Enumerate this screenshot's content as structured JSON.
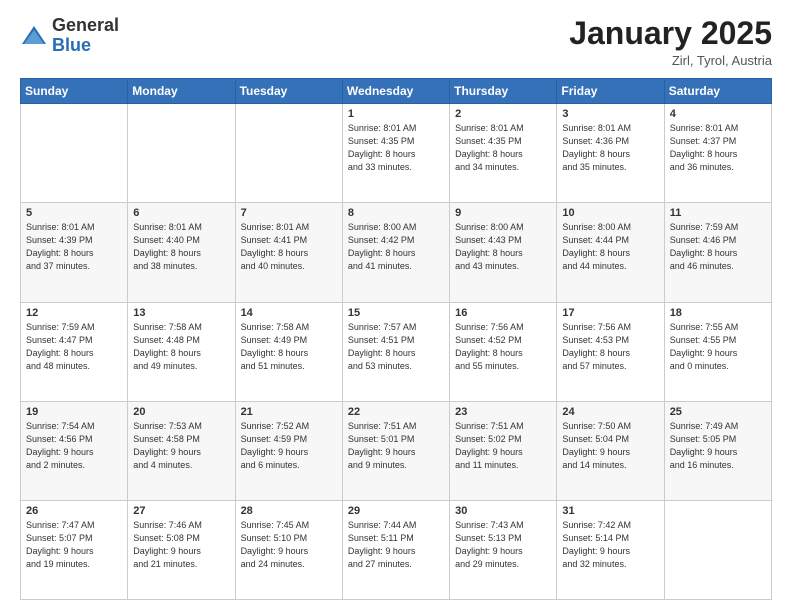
{
  "header": {
    "logo": {
      "general": "General",
      "blue": "Blue"
    },
    "title": "January 2025",
    "location": "Zirl, Tyrol, Austria"
  },
  "weekdays": [
    "Sunday",
    "Monday",
    "Tuesday",
    "Wednesday",
    "Thursday",
    "Friday",
    "Saturday"
  ],
  "weeks": [
    [
      {
        "day": "",
        "info": ""
      },
      {
        "day": "",
        "info": ""
      },
      {
        "day": "",
        "info": ""
      },
      {
        "day": "1",
        "info": "Sunrise: 8:01 AM\nSunset: 4:35 PM\nDaylight: 8 hours\nand 33 minutes."
      },
      {
        "day": "2",
        "info": "Sunrise: 8:01 AM\nSunset: 4:35 PM\nDaylight: 8 hours\nand 34 minutes."
      },
      {
        "day": "3",
        "info": "Sunrise: 8:01 AM\nSunset: 4:36 PM\nDaylight: 8 hours\nand 35 minutes."
      },
      {
        "day": "4",
        "info": "Sunrise: 8:01 AM\nSunset: 4:37 PM\nDaylight: 8 hours\nand 36 minutes."
      }
    ],
    [
      {
        "day": "5",
        "info": "Sunrise: 8:01 AM\nSunset: 4:39 PM\nDaylight: 8 hours\nand 37 minutes."
      },
      {
        "day": "6",
        "info": "Sunrise: 8:01 AM\nSunset: 4:40 PM\nDaylight: 8 hours\nand 38 minutes."
      },
      {
        "day": "7",
        "info": "Sunrise: 8:01 AM\nSunset: 4:41 PM\nDaylight: 8 hours\nand 40 minutes."
      },
      {
        "day": "8",
        "info": "Sunrise: 8:00 AM\nSunset: 4:42 PM\nDaylight: 8 hours\nand 41 minutes."
      },
      {
        "day": "9",
        "info": "Sunrise: 8:00 AM\nSunset: 4:43 PM\nDaylight: 8 hours\nand 43 minutes."
      },
      {
        "day": "10",
        "info": "Sunrise: 8:00 AM\nSunset: 4:44 PM\nDaylight: 8 hours\nand 44 minutes."
      },
      {
        "day": "11",
        "info": "Sunrise: 7:59 AM\nSunset: 4:46 PM\nDaylight: 8 hours\nand 46 minutes."
      }
    ],
    [
      {
        "day": "12",
        "info": "Sunrise: 7:59 AM\nSunset: 4:47 PM\nDaylight: 8 hours\nand 48 minutes."
      },
      {
        "day": "13",
        "info": "Sunrise: 7:58 AM\nSunset: 4:48 PM\nDaylight: 8 hours\nand 49 minutes."
      },
      {
        "day": "14",
        "info": "Sunrise: 7:58 AM\nSunset: 4:49 PM\nDaylight: 8 hours\nand 51 minutes."
      },
      {
        "day": "15",
        "info": "Sunrise: 7:57 AM\nSunset: 4:51 PM\nDaylight: 8 hours\nand 53 minutes."
      },
      {
        "day": "16",
        "info": "Sunrise: 7:56 AM\nSunset: 4:52 PM\nDaylight: 8 hours\nand 55 minutes."
      },
      {
        "day": "17",
        "info": "Sunrise: 7:56 AM\nSunset: 4:53 PM\nDaylight: 8 hours\nand 57 minutes."
      },
      {
        "day": "18",
        "info": "Sunrise: 7:55 AM\nSunset: 4:55 PM\nDaylight: 9 hours\nand 0 minutes."
      }
    ],
    [
      {
        "day": "19",
        "info": "Sunrise: 7:54 AM\nSunset: 4:56 PM\nDaylight: 9 hours\nand 2 minutes."
      },
      {
        "day": "20",
        "info": "Sunrise: 7:53 AM\nSunset: 4:58 PM\nDaylight: 9 hours\nand 4 minutes."
      },
      {
        "day": "21",
        "info": "Sunrise: 7:52 AM\nSunset: 4:59 PM\nDaylight: 9 hours\nand 6 minutes."
      },
      {
        "day": "22",
        "info": "Sunrise: 7:51 AM\nSunset: 5:01 PM\nDaylight: 9 hours\nand 9 minutes."
      },
      {
        "day": "23",
        "info": "Sunrise: 7:51 AM\nSunset: 5:02 PM\nDaylight: 9 hours\nand 11 minutes."
      },
      {
        "day": "24",
        "info": "Sunrise: 7:50 AM\nSunset: 5:04 PM\nDaylight: 9 hours\nand 14 minutes."
      },
      {
        "day": "25",
        "info": "Sunrise: 7:49 AM\nSunset: 5:05 PM\nDaylight: 9 hours\nand 16 minutes."
      }
    ],
    [
      {
        "day": "26",
        "info": "Sunrise: 7:47 AM\nSunset: 5:07 PM\nDaylight: 9 hours\nand 19 minutes."
      },
      {
        "day": "27",
        "info": "Sunrise: 7:46 AM\nSunset: 5:08 PM\nDaylight: 9 hours\nand 21 minutes."
      },
      {
        "day": "28",
        "info": "Sunrise: 7:45 AM\nSunset: 5:10 PM\nDaylight: 9 hours\nand 24 minutes."
      },
      {
        "day": "29",
        "info": "Sunrise: 7:44 AM\nSunset: 5:11 PM\nDaylight: 9 hours\nand 27 minutes."
      },
      {
        "day": "30",
        "info": "Sunrise: 7:43 AM\nSunset: 5:13 PM\nDaylight: 9 hours\nand 29 minutes."
      },
      {
        "day": "31",
        "info": "Sunrise: 7:42 AM\nSunset: 5:14 PM\nDaylight: 9 hours\nand 32 minutes."
      },
      {
        "day": "",
        "info": ""
      }
    ]
  ]
}
